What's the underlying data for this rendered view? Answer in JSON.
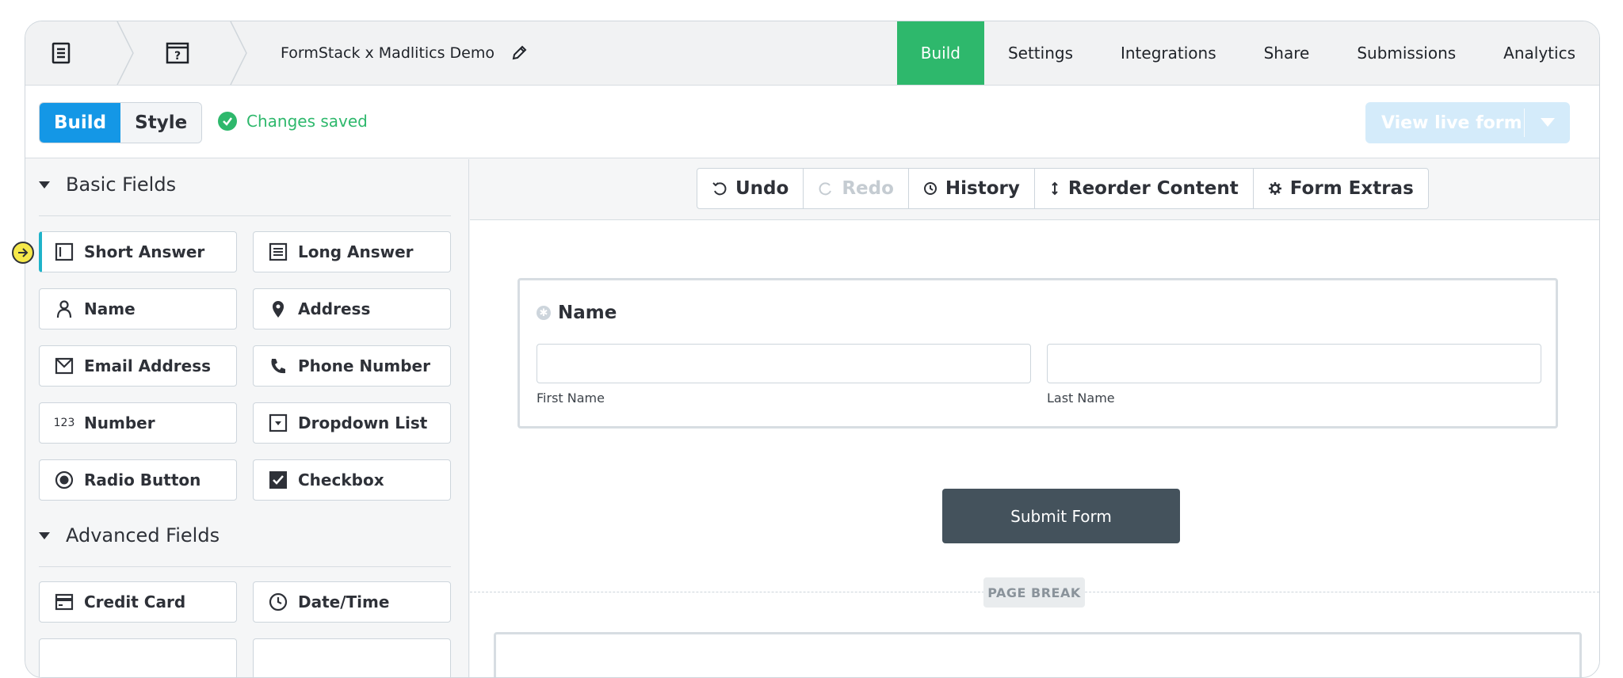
{
  "breadcrumb": {
    "doc_icon": "document-icon",
    "question_icon": "help-page-icon"
  },
  "form_title": "FormStack x Madlitics Demo",
  "nav_tabs": [
    {
      "label": "Build",
      "active": true
    },
    {
      "label": "Settings"
    },
    {
      "label": "Integrations"
    },
    {
      "label": "Share"
    },
    {
      "label": "Submissions"
    },
    {
      "label": "Analytics"
    }
  ],
  "mode": {
    "build": "Build",
    "style": "Style"
  },
  "status": "Changes saved",
  "live_button": "View live form",
  "basic_fields": {
    "title": "Basic Fields",
    "items": [
      {
        "label": "Short Answer",
        "icon": "short-answer-icon"
      },
      {
        "label": "Long Answer",
        "icon": "long-answer-icon"
      },
      {
        "label": "Name",
        "icon": "person-icon"
      },
      {
        "label": "Address",
        "icon": "map-pin-icon"
      },
      {
        "label": "Email Address",
        "icon": "envelope-icon"
      },
      {
        "label": "Phone Number",
        "icon": "phone-icon"
      },
      {
        "label": "Number",
        "icon": "number-icon",
        "glyph": "123"
      },
      {
        "label": "Dropdown List",
        "icon": "dropdown-icon"
      },
      {
        "label": "Radio Button",
        "icon": "radio-icon"
      },
      {
        "label": "Checkbox",
        "icon": "checkbox-icon"
      }
    ]
  },
  "advanced_fields": {
    "title": "Advanced Fields",
    "items": [
      {
        "label": "Credit Card",
        "icon": "credit-card-icon"
      },
      {
        "label": "Date/Time",
        "icon": "clock-icon"
      }
    ]
  },
  "toolbar": {
    "undo": "Undo",
    "redo": "Redo",
    "history": "History",
    "reorder": "Reorder Content",
    "extras": "Form Extras"
  },
  "name_field": {
    "label": "Name",
    "first": "First Name",
    "last": "Last Name"
  },
  "submit_label": "Submit Form",
  "page_break": "PAGE BREAK",
  "colors": {
    "accent_green": "#2eb86c",
    "accent_blue": "#1497e6",
    "submit_bg": "#44525c"
  }
}
